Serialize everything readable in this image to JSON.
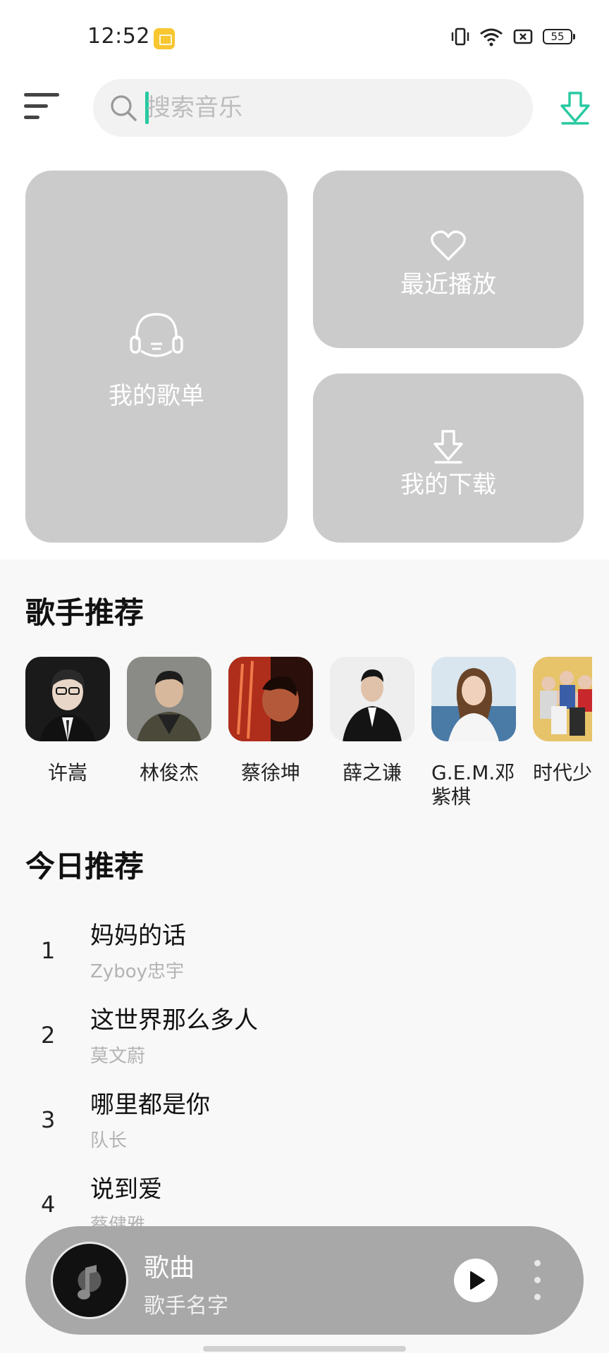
{
  "status_bar": {
    "time": "12:52",
    "battery": "55",
    "icons": [
      "notification-app-icon",
      "vibrate-icon",
      "wifi-icon",
      "sim-icon",
      "battery-icon"
    ]
  },
  "header": {
    "search_placeholder": "搜索音乐",
    "accent_color": "#27c9a0"
  },
  "tiles": {
    "playlist_label": "我的歌单",
    "recent_label": "最近播放",
    "downloads_label": "我的下载"
  },
  "singers": {
    "title": "歌手推荐",
    "items": [
      {
        "name": "许嵩"
      },
      {
        "name": "林俊杰"
      },
      {
        "name": "蔡徐坤"
      },
      {
        "name": "薛之谦"
      },
      {
        "name": "G.E.M.邓紫棋"
      },
      {
        "name": "时代少团"
      }
    ]
  },
  "today": {
    "title": "今日推荐",
    "songs": [
      {
        "rank": "1",
        "title": "妈妈的话",
        "artist": "Zyboy忠宇"
      },
      {
        "rank": "2",
        "title": "这世界那么多人",
        "artist": "莫文蔚"
      },
      {
        "rank": "3",
        "title": "哪里都是你",
        "artist": "队长"
      },
      {
        "rank": "4",
        "title": "说到爱",
        "artist": "蔡健雅"
      }
    ]
  },
  "player": {
    "song_title": "歌曲",
    "artist": "歌手名字"
  }
}
